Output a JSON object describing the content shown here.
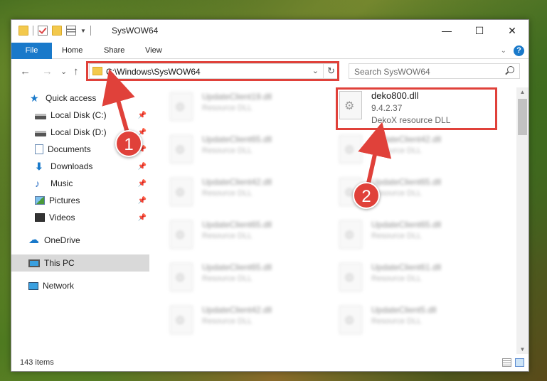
{
  "window": {
    "title": "SysWOW64",
    "controls": {
      "minimize": "—",
      "maximize": "☐",
      "close": "✕"
    }
  },
  "ribbon": {
    "tabs": [
      "File",
      "Home",
      "Share",
      "View"
    ],
    "help": "?",
    "collapse": "⌄"
  },
  "nav": {
    "back": "←",
    "forward": "→",
    "recent": "⌄",
    "up": "↑"
  },
  "address": {
    "path": "C:\\Windows\\SysWOW64",
    "dropdown": "⌄",
    "refresh": "↻"
  },
  "search": {
    "placeholder": "Search SysWOW64"
  },
  "sidebar": {
    "items": [
      {
        "label": "Quick access",
        "icon": "star-icon"
      },
      {
        "label": "Local Disk (C:)",
        "icon": "disk-icon",
        "pinned": true
      },
      {
        "label": "Local Disk (D:)",
        "icon": "disk-icon",
        "pinned": true
      },
      {
        "label": "Documents",
        "icon": "documents-icon",
        "pinned": true
      },
      {
        "label": "Downloads",
        "icon": "downloads-icon",
        "pinned": true
      },
      {
        "label": "Music",
        "icon": "music-icon",
        "pinned": true
      },
      {
        "label": "Pictures",
        "icon": "pictures-icon",
        "pinned": true
      },
      {
        "label": "Videos",
        "icon": "videos-icon",
        "pinned": true
      },
      {
        "label": "OneDrive",
        "icon": "cloud-icon"
      },
      {
        "label": "This PC",
        "icon": "computer-icon",
        "selected": true
      },
      {
        "label": "Network",
        "icon": "network-icon"
      }
    ],
    "pin_glyph": "📌"
  },
  "files": {
    "left": [
      {
        "name": "UpdateClient19.dll",
        "type": "Resource DLL"
      },
      {
        "name": "UpdateClient65.dll",
        "type": "Resource DLL"
      },
      {
        "name": "UpdateClient42.dll",
        "type": "Resource DLL"
      },
      {
        "name": "UpdateClient65.dll",
        "type": "Resource DLL"
      },
      {
        "name": "UpdateClient65.dll",
        "type": "Resource DLL"
      },
      {
        "name": "UpdateClient42.dll",
        "type": "Resource DLL"
      }
    ],
    "right": [
      {
        "name": "deko800.dll",
        "version": "9.4.2.37",
        "type": "DekoX resource DLL"
      },
      {
        "name": "UpdateClient42.dll",
        "type": "Resource DLL"
      },
      {
        "name": "UpdateClient65.dll",
        "type": "Resource DLL"
      },
      {
        "name": "UpdateClient65.dll",
        "type": "Resource DLL"
      },
      {
        "name": "UpdateClient61.dll",
        "type": "Resource DLL"
      },
      {
        "name": "UpdateClient5.dll",
        "type": "Resource DLL"
      }
    ]
  },
  "status": {
    "count": "143 items"
  },
  "annotations": {
    "step1": "1",
    "step2": "2",
    "color": "#e0413a"
  }
}
